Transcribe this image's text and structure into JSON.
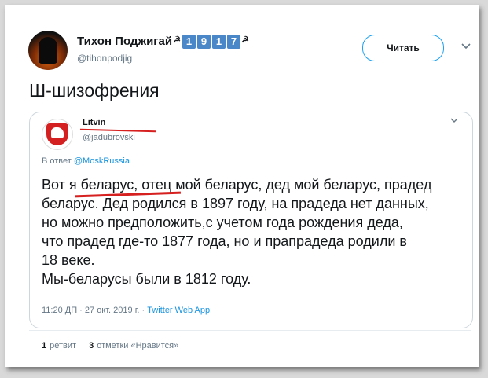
{
  "tweet": {
    "author_name": "Тихон Поджигай",
    "author_badge_symbol": "☭",
    "author_badge_digits": [
      "1",
      "9",
      "1",
      "7"
    ],
    "author_handle": "@tihonpodjig",
    "follow_label": "Читать",
    "text": "Ш-шизофрения"
  },
  "quote": {
    "author_name": "Litvin",
    "author_handle": "@jadubrovski",
    "reply_prefix": "В ответ ",
    "reply_mention": "@MoskRussia",
    "body_lines": [
      "Вот я беларус, отец мой беларус, дед мой беларус, прадед",
      "беларус. Дед родился в 1897 году, на прадеда нет данных,",
      "но можно предположить,с учетом года рождения деда,",
      "что прадед где-то 1877 года, но и прапрадеда  родили в",
      "18 веке.",
      "Мы-беларусы были в 1812 году."
    ],
    "timestamp": "11:20 ДП · 27 окт. 2019 г. · ",
    "app": "Twitter Web App"
  },
  "stats": {
    "retweets_count": "1",
    "retweets_label": "ретвит",
    "likes_count": "3",
    "likes_label": "отметки «Нравится»"
  },
  "colors": {
    "accent": "#1da1f2",
    "highlight_underline": "#d62020",
    "badge": "#4a87c8"
  }
}
